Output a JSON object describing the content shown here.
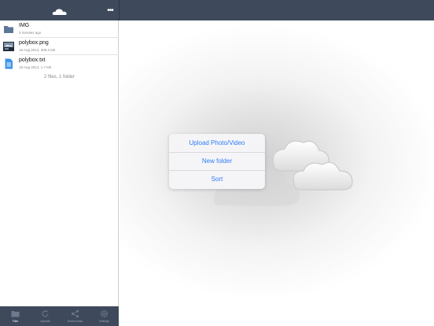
{
  "header": {
    "logo_icon": "cloud-icon",
    "more_icon": "ellipsis-icon",
    "more_label": "•••"
  },
  "files": [
    {
      "name": "IMG",
      "meta": "3 minutes ago",
      "icon": "folder-icon"
    },
    {
      "name": "polybox.png",
      "meta": "18 Aug 2014, 308.3 KB",
      "icon": "image-thumbnail"
    },
    {
      "name": "polybox.txt",
      "meta": "18 Aug 2014, 1.7 KB",
      "icon": "text-file-icon"
    }
  ],
  "summary": "2 files, 1 folder",
  "tabs": [
    {
      "label": "Files",
      "icon": "folder-icon",
      "active": true
    },
    {
      "label": "Uploads",
      "icon": "refresh-icon",
      "active": false
    },
    {
      "label": "Shared links",
      "icon": "share-icon",
      "active": false
    },
    {
      "label": "Settings",
      "icon": "gear-icon",
      "active": false
    }
  ],
  "menu": {
    "items": [
      "Upload Photo/Video",
      "New folder",
      "Sort"
    ]
  },
  "colors": {
    "bar": "#3e4a5c",
    "accent": "#2f7cf6",
    "folder": "#5d7799",
    "file": "#3d95e8"
  }
}
